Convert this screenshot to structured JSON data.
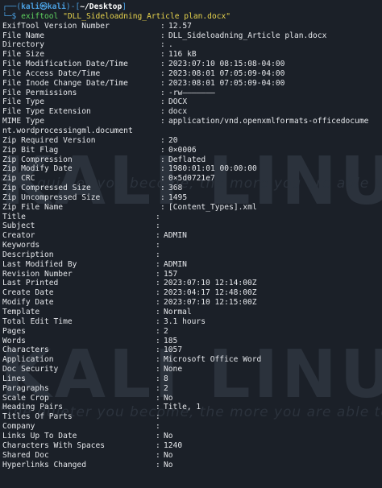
{
  "prompt": {
    "user": "kali",
    "at": "㉿",
    "host": "kali",
    "path": "~/Desktop",
    "cmd": "exiftool",
    "arg": "\"DLL_Sideloadning_Article plan.docx\""
  },
  "watermark": {
    "big1": "KALI LINUX",
    "tag1": "\"the quieter you become, the more you are able to hear\"",
    "big2": "KALI LINUX",
    "tag2": "\"the quieter you become, the more you are able to hear\""
  },
  "fields1": [
    {
      "k": "ExifTool Version Number",
      "v": "12.57"
    },
    {
      "k": "File Name",
      "v": "DLL_Sideloadning_Article plan.docx"
    },
    {
      "k": "Directory",
      "v": "."
    },
    {
      "k": "File Size",
      "v": "116 kB"
    },
    {
      "k": "File Modification Date/Time",
      "v": "2023:07:10 08:15:08-04:00"
    },
    {
      "k": "File Access Date/Time",
      "v": "2023:08:01 07:05:09-04:00"
    },
    {
      "k": "File Inode Change Date/Time",
      "v": "2023:08:01 07:05:09-04:00"
    },
    {
      "k": "File Permissions",
      "v": "-rw———————"
    },
    {
      "k": "File Type",
      "v": "DOCX"
    },
    {
      "k": "File Type Extension",
      "v": "docx"
    },
    {
      "k": "MIME Type",
      "v": "application/vnd.openxmlformats-officedocume"
    }
  ],
  "mime_wrap": "nt.wordprocessingml.document",
  "fields2": [
    {
      "k": "Zip Required Version",
      "v": "20"
    },
    {
      "k": "Zip Bit Flag",
      "v": "0×0006"
    },
    {
      "k": "Zip Compression",
      "v": "Deflated"
    },
    {
      "k": "Zip Modify Date",
      "v": "1980:01:01 00:00:00"
    },
    {
      "k": "Zip CRC",
      "v": "0×5d0721e7"
    },
    {
      "k": "Zip Compressed Size",
      "v": "368"
    },
    {
      "k": "Zip Uncompressed Size",
      "v": "1495"
    },
    {
      "k": "Zip File Name",
      "v": "[Content_Types].xml"
    }
  ],
  "fields3": [
    {
      "k": "Title",
      "v": ""
    },
    {
      "k": "Subject",
      "v": ""
    },
    {
      "k": "Creator",
      "v": "ADMIN"
    },
    {
      "k": "Keywords",
      "v": ""
    },
    {
      "k": "Description",
      "v": ""
    },
    {
      "k": "Last Modified By",
      "v": "ADMIN"
    },
    {
      "k": "Revision Number",
      "v": "157"
    },
    {
      "k": "Last Printed",
      "v": "2023:07:10 12:14:00Z"
    },
    {
      "k": "Create Date",
      "v": "2023:04:17 12:48:00Z"
    },
    {
      "k": "Modify Date",
      "v": "2023:07:10 12:15:00Z"
    },
    {
      "k": "Template",
      "v": "Normal"
    },
    {
      "k": "Total Edit Time",
      "v": "3.1 hours"
    },
    {
      "k": "Pages",
      "v": "2"
    },
    {
      "k": "Words",
      "v": "185"
    },
    {
      "k": "Characters",
      "v": "1057"
    },
    {
      "k": "Application",
      "v": "Microsoft Office Word"
    },
    {
      "k": "Doc Security",
      "v": "None"
    },
    {
      "k": "Lines",
      "v": "8"
    },
    {
      "k": "Paragraphs",
      "v": "2"
    },
    {
      "k": "Scale Crop",
      "v": "No"
    },
    {
      "k": "Heading Pairs",
      "v": "Title, 1"
    },
    {
      "k": "Titles Of Parts",
      "v": ""
    },
    {
      "k": "Company",
      "v": ""
    },
    {
      "k": "Links Up To Date",
      "v": "No"
    },
    {
      "k": "Characters With Spaces",
      "v": "1240"
    },
    {
      "k": "Shared Doc",
      "v": "No"
    },
    {
      "k": "Hyperlinks Changed",
      "v": "No"
    }
  ]
}
